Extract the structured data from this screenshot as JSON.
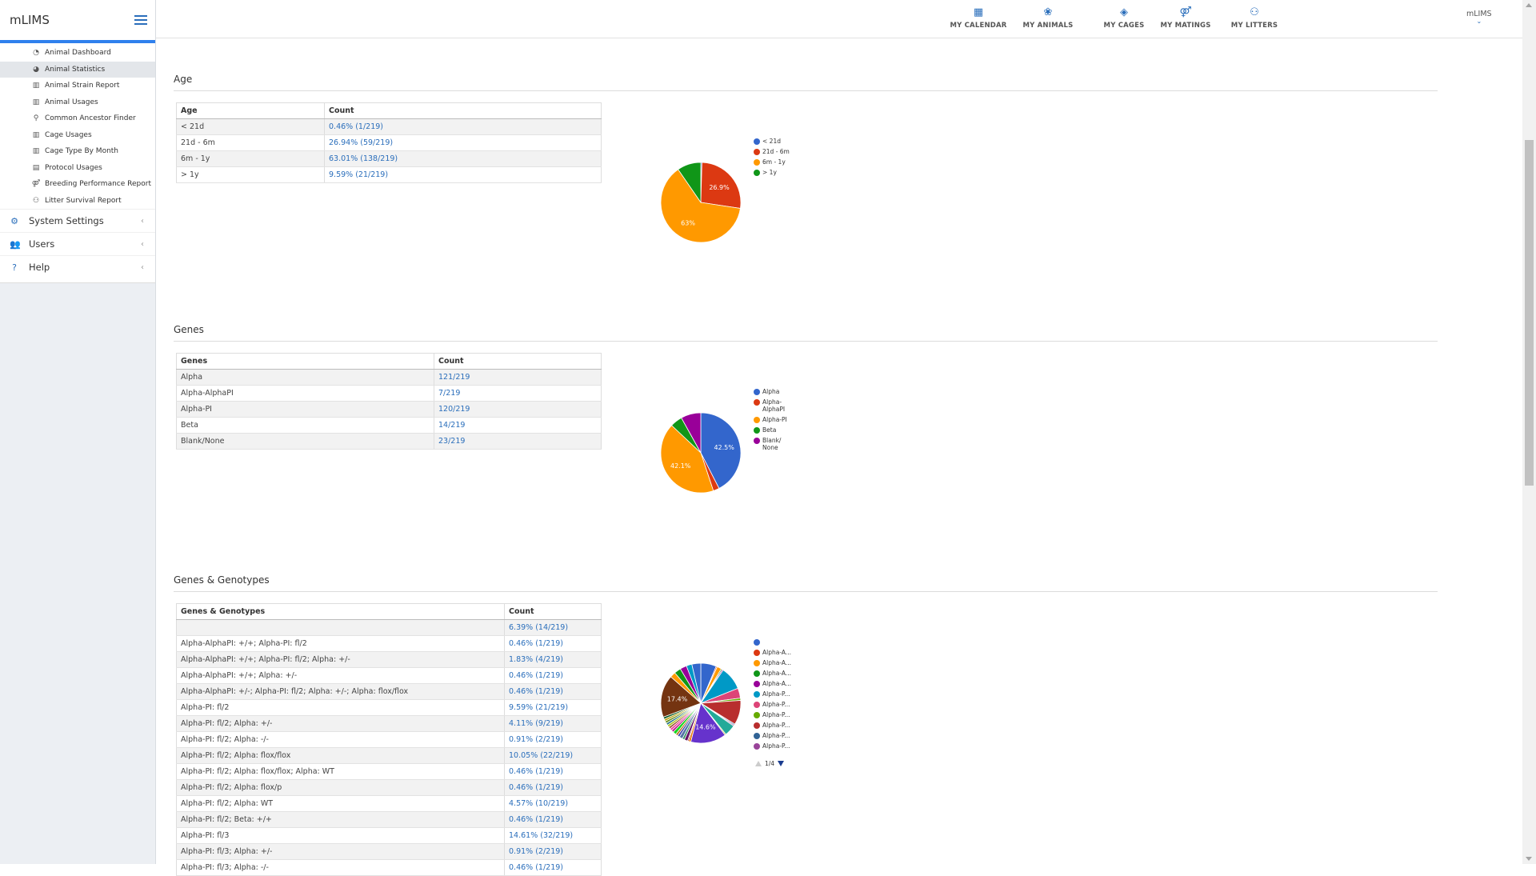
{
  "app": {
    "brand": "mLIMS",
    "user": "mLIMS"
  },
  "sidebar": {
    "reports": [
      {
        "label": "Animal Dashboard",
        "icon": "dashboard-icon",
        "glyph": "◔",
        "active": false
      },
      {
        "label": "Animal Statistics",
        "icon": "pie-chart-icon",
        "glyph": "◕",
        "active": true
      },
      {
        "label": "Animal Strain Report",
        "icon": "bar-chart-icon",
        "glyph": "▥",
        "active": false
      },
      {
        "label": "Animal Usages",
        "icon": "bar-chart-icon",
        "glyph": "▥",
        "active": false
      },
      {
        "label": "Common Ancestor Finder",
        "icon": "search-icon",
        "glyph": "⚲",
        "active": false
      },
      {
        "label": "Cage Usages",
        "icon": "bar-chart-icon",
        "glyph": "▥",
        "active": false
      },
      {
        "label": "Cage Type By Month",
        "icon": "bar-chart-icon",
        "glyph": "▥",
        "active": false
      },
      {
        "label": "Protocol Usages",
        "icon": "book-icon",
        "glyph": "▤",
        "active": false
      },
      {
        "label": "Breeding Performance Report",
        "icon": "mating-icon",
        "glyph": "⚤",
        "active": false
      },
      {
        "label": "Litter Survival Report",
        "icon": "litter-icon",
        "glyph": "⚇",
        "active": false
      }
    ],
    "sections": [
      {
        "label": "System Settings",
        "icon": "gear-icon",
        "glyph": "⚙"
      },
      {
        "label": "Users",
        "icon": "users-icon",
        "glyph": "👥"
      },
      {
        "label": "Help",
        "icon": "question-icon",
        "glyph": "?"
      }
    ]
  },
  "topnav": [
    {
      "label": "MY CALENDAR",
      "icon": "calendar-icon",
      "glyph": "▦"
    },
    {
      "label": "MY ANIMALS",
      "icon": "paw-icon",
      "glyph": "❀"
    },
    {
      "label": "MY CAGES",
      "icon": "cube-icon",
      "glyph": "◈"
    },
    {
      "label": "MY MATINGS",
      "icon": "mating-icon",
      "glyph": "⚤"
    },
    {
      "label": "MY LITTERS",
      "icon": "litter-icon",
      "glyph": "⚇"
    }
  ],
  "age": {
    "title": "Age",
    "col1": "Age",
    "col2": "Count",
    "rows": [
      {
        "label": "< 21d",
        "count": "0.46% (1/219)"
      },
      {
        "label": "21d - 6m",
        "count": "26.94% (59/219)"
      },
      {
        "label": "6m - 1y",
        "count": "63.01% (138/219)"
      },
      {
        "label": "> 1y",
        "count": "9.59% (21/219)"
      }
    ]
  },
  "genes": {
    "title": "Genes",
    "col1": "Genes",
    "col2": "Count",
    "rows": [
      {
        "label": "Alpha",
        "count": "121/219"
      },
      {
        "label": "Alpha-AlphaPI",
        "count": "7/219"
      },
      {
        "label": "Alpha-PI",
        "count": "120/219"
      },
      {
        "label": "Beta",
        "count": "14/219"
      },
      {
        "label": "Blank/None",
        "count": "23/219"
      }
    ]
  },
  "genotypes": {
    "title": "Genes & Genotypes",
    "col1": "Genes & Genotypes",
    "col2": "Count",
    "rows": [
      {
        "label": "",
        "count": "6.39% (14/219)"
      },
      {
        "label": "Alpha-AlphaPI: +/+; Alpha-PI: fl/2",
        "count": "0.46% (1/219)"
      },
      {
        "label": "Alpha-AlphaPI: +/+; Alpha-PI: fl/2; Alpha: +/-",
        "count": "1.83% (4/219)"
      },
      {
        "label": "Alpha-AlphaPI: +/+; Alpha: +/-",
        "count": "0.46% (1/219)"
      },
      {
        "label": "Alpha-AlphaPI: +/-; Alpha-PI: fl/2; Alpha: +/-; Alpha: flox/flox",
        "count": "0.46% (1/219)"
      },
      {
        "label": "Alpha-PI: fl/2",
        "count": "9.59% (21/219)"
      },
      {
        "label": "Alpha-PI: fl/2; Alpha: +/-",
        "count": "4.11% (9/219)"
      },
      {
        "label": "Alpha-PI: fl/2; Alpha: -/-",
        "count": "0.91% (2/219)"
      },
      {
        "label": "Alpha-PI: fl/2; Alpha: flox/flox",
        "count": "10.05% (22/219)"
      },
      {
        "label": "Alpha-PI: fl/2; Alpha: flox/flox; Alpha: WT",
        "count": "0.46% (1/219)"
      },
      {
        "label": "Alpha-PI: fl/2; Alpha: flox/p",
        "count": "0.46% (1/219)"
      },
      {
        "label": "Alpha-PI: fl/2; Alpha: WT",
        "count": "4.57% (10/219)"
      },
      {
        "label": "Alpha-PI: fl/2; Beta: +/+",
        "count": "0.46% (1/219)"
      },
      {
        "label": "Alpha-PI: fl/3",
        "count": "14.61% (32/219)"
      },
      {
        "label": "Alpha-PI: fl/3; Alpha: +/-",
        "count": "0.91% (2/219)"
      },
      {
        "label": "Alpha-PI: fl/3; Alpha: -/-",
        "count": "0.46% (1/219)"
      }
    ],
    "pager": "1/4"
  },
  "chart_data": [
    {
      "type": "pie",
      "title": "",
      "legend": "right",
      "slices": [
        {
          "label": "< 21d",
          "value": 1,
          "color": "#3366cc",
          "display": ""
        },
        {
          "label": "21d - 6m",
          "value": 59,
          "color": "#dc3912",
          "display": "26.9%"
        },
        {
          "label": "6m - 1y",
          "value": 138,
          "color": "#ff9900",
          "display": "63%"
        },
        {
          "label": "> 1y",
          "value": 21,
          "color": "#109618",
          "display": ""
        }
      ]
    },
    {
      "type": "pie",
      "title": "",
      "legend": "right",
      "slices": [
        {
          "label": "Alpha",
          "legend": [
            "Alpha"
          ],
          "value": 121,
          "color": "#3366cc",
          "display": "42.5%"
        },
        {
          "label": "Alpha-AlphaPI",
          "legend": [
            "Alpha-",
            "AlphaPI"
          ],
          "value": 7,
          "color": "#dc3912",
          "display": ""
        },
        {
          "label": "Alpha-PI",
          "legend": [
            "Alpha-PI"
          ],
          "value": 120,
          "color": "#ff9900",
          "display": "42.1%"
        },
        {
          "label": "Beta",
          "legend": [
            "Beta"
          ],
          "value": 14,
          "color": "#109618",
          "display": ""
        },
        {
          "label": "Blank/None",
          "legend": [
            "Blank/",
            "None"
          ],
          "value": 23,
          "color": "#990099",
          "display": ""
        }
      ]
    },
    {
      "type": "pie",
      "title": "",
      "legend": "right",
      "legend_entries": [
        "",
        "Alpha-A...",
        "Alpha-A...",
        "Alpha-A...",
        "Alpha-A...",
        "Alpha-P...",
        "Alpha-P...",
        "Alpha-P...",
        "Alpha-P...",
        "Alpha-P...",
        "Alpha-P..."
      ],
      "slices": [
        {
          "value": 14,
          "color": "#3366cc",
          "display": ""
        },
        {
          "value": 1,
          "color": "#dc3912",
          "display": ""
        },
        {
          "value": 4,
          "color": "#ff9900",
          "display": ""
        },
        {
          "value": 1,
          "color": "#109618",
          "display": ""
        },
        {
          "value": 1,
          "color": "#990099",
          "display": ""
        },
        {
          "value": 21,
          "color": "#0099c6",
          "display": ""
        },
        {
          "value": 9,
          "color": "#dd4477",
          "display": ""
        },
        {
          "value": 2,
          "color": "#66aa00",
          "display": ""
        },
        {
          "value": 22,
          "color": "#b82e2e",
          "display": ""
        },
        {
          "value": 1,
          "color": "#316395",
          "display": ""
        },
        {
          "value": 1,
          "color": "#994499",
          "display": ""
        },
        {
          "value": 10,
          "color": "#22aa99",
          "display": ""
        },
        {
          "value": 1,
          "color": "#aaaa11",
          "display": ""
        },
        {
          "value": 32,
          "color": "#6633cc",
          "display": "14.6%"
        },
        {
          "value": 2,
          "color": "#e67300",
          "display": ""
        },
        {
          "value": 1,
          "color": "#8b0707",
          "display": ""
        },
        {
          "value": 3,
          "color": "#651067",
          "display": ""
        },
        {
          "value": 2,
          "color": "#329262",
          "display": ""
        },
        {
          "value": 3,
          "color": "#5574a6",
          "display": ""
        },
        {
          "value": 2,
          "color": "#3b3eac",
          "display": ""
        },
        {
          "value": 2,
          "color": "#b77322",
          "display": ""
        },
        {
          "value": 3,
          "color": "#16d620",
          "display": ""
        },
        {
          "value": 2,
          "color": "#b91383",
          "display": ""
        },
        {
          "value": 2,
          "color": "#f4359e",
          "display": ""
        },
        {
          "value": 2,
          "color": "#9c5935",
          "display": ""
        },
        {
          "value": 2,
          "color": "#a9c413",
          "display": ""
        },
        {
          "value": 2,
          "color": "#2a778d",
          "display": ""
        },
        {
          "value": 2,
          "color": "#668d1c",
          "display": ""
        },
        {
          "value": 2,
          "color": "#bea413",
          "display": ""
        },
        {
          "value": 2,
          "color": "#0c5922",
          "display": ""
        },
        {
          "value": 38,
          "color": "#743411",
          "display": "17.4%"
        },
        {
          "value": 5,
          "color": "#ff9900",
          "display": ""
        },
        {
          "value": 6,
          "color": "#109618",
          "display": ""
        },
        {
          "value": 6,
          "color": "#990099",
          "display": ""
        },
        {
          "value": 5,
          "color": "#0099c6",
          "display": ""
        },
        {
          "value": 8,
          "color": "#3366cc",
          "display": ""
        }
      ]
    }
  ]
}
